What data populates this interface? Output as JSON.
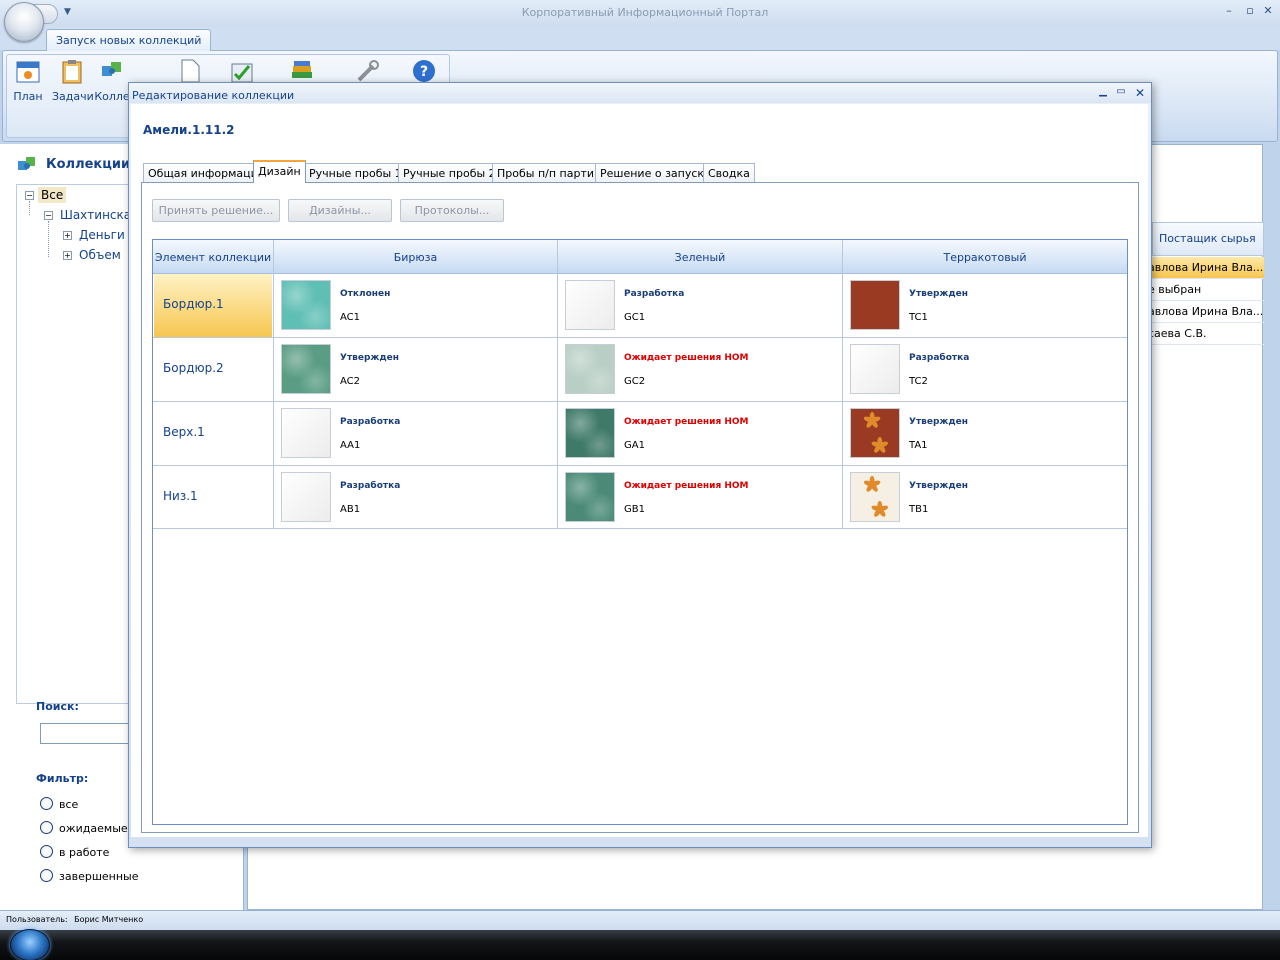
{
  "app": {
    "title": "Корпоративный Информационный Портал",
    "window_controls": [
      "–",
      "▫",
      "✕"
    ]
  },
  "ribbon": {
    "tab": "Запуск новых коллекций",
    "buttons": [
      {
        "label": "План",
        "icon": "calendar-icon"
      },
      {
        "label": "Задачи",
        "icon": "clipboard-icon"
      },
      {
        "label": "Колле",
        "icon": "puzzle-icon"
      },
      {
        "label": "",
        "icon": "document-icon"
      },
      {
        "label": "",
        "icon": "checklist-icon"
      },
      {
        "label": "",
        "icon": "books-icon"
      },
      {
        "label": "",
        "icon": "tools-icon"
      },
      {
        "label": "",
        "icon": "help-icon"
      }
    ]
  },
  "left_panel": {
    "title": "Коллекции",
    "tree": {
      "root": "Все",
      "child": "Шахтинская",
      "leaves": [
        "Деньги",
        "Объем"
      ]
    },
    "search_label": "Поиск:",
    "search_value": "",
    "filter_label": "Фильтр:",
    "filters": [
      "все",
      "ожидаемые п",
      "в работе",
      "завершенные"
    ]
  },
  "right_panel": {
    "column_header": "Постащик сырья",
    "rows": [
      "авлова Ирина Вла...",
      "е выбран",
      "авлова Ирина Вла...",
      "саева С.В."
    ]
  },
  "status": {
    "label": "Пользователь:",
    "user": "Борис Митченко"
  },
  "dialog": {
    "title": "Редактирование коллекции",
    "collection_name": "Амели.1.11.2",
    "tabs": [
      "Общая информация",
      "Дизайн",
      "Ручные пробы 1",
      "Ручные пробы 2",
      "Пробы п/п партии",
      "Решение о запуске",
      "Сводка"
    ],
    "active_tab": "Дизайн",
    "actions": [
      "Принять решение...",
      "Дизайны...",
      "Протоколы..."
    ],
    "grid": {
      "headers": [
        "Элемент коллекции",
        "Бирюза",
        "Зеленый",
        "Терракотовый"
      ],
      "selected_row": "Бордюр.1",
      "rows": [
        {
          "name": "Бордюр.1",
          "cells": [
            {
              "status": "Отклонен",
              "code": "AC1",
              "alert": false,
              "swatch": "#5fbfb4"
            },
            {
              "status": "Разработка",
              "code": "GC1",
              "alert": false,
              "swatch": "#f4f4f4"
            },
            {
              "status": "Утвержден",
              "code": "TC1",
              "alert": false,
              "swatch": "#9a3a22"
            }
          ]
        },
        {
          "name": "Бордюр.2",
          "cells": [
            {
              "status": "Утвержден",
              "code": "AC2",
              "alert": false,
              "swatch": "#5a9d84"
            },
            {
              "status": "Ожидает решения НОМ",
              "code": "GC2",
              "alert": true,
              "swatch": "#b9cfc6"
            },
            {
              "status": "Разработка",
              "code": "TC2",
              "alert": false,
              "swatch": "#f4f4f4"
            }
          ]
        },
        {
          "name": "Верх.1",
          "cells": [
            {
              "status": "Разработка",
              "code": "AA1",
              "alert": false,
              "swatch": "#f4f4f4"
            },
            {
              "status": "Ожидает решения НОМ",
              "code": "GA1",
              "alert": true,
              "swatch": "#3f7a68"
            },
            {
              "status": "Утвержден",
              "code": "TA1",
              "alert": false,
              "swatch": "#9a3a22"
            }
          ]
        },
        {
          "name": "Низ.1",
          "cells": [
            {
              "status": "Разработка",
              "code": "AB1",
              "alert": false,
              "swatch": "#f4f4f4"
            },
            {
              "status": "Ожидает решения НОМ",
              "code": "GB1",
              "alert": true,
              "swatch": "#4a8a76"
            },
            {
              "status": "Утвержден",
              "code": "TB1",
              "alert": false,
              "swatch": "#f6f0e4"
            }
          ]
        }
      ]
    }
  },
  "colors": {
    "accent": "#15428b",
    "alert": "#e00000",
    "selected_row": "#f7c64f"
  }
}
